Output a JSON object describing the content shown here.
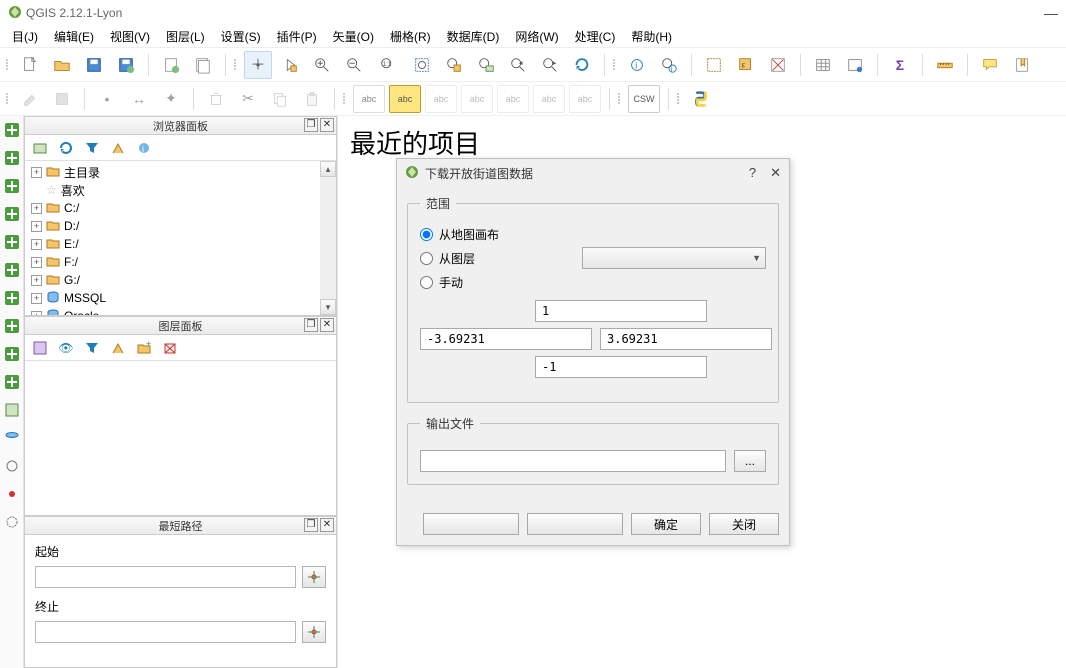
{
  "window": {
    "title": "QGIS 2.12.1-Lyon"
  },
  "menu": {
    "items": [
      "目(J)",
      "编辑(E)",
      "视图(V)",
      "图层(L)",
      "设置(S)",
      "插件(P)",
      "矢量(O)",
      "栅格(R)",
      "数据库(D)",
      "网络(W)",
      "处理(C)",
      "帮助(H)"
    ]
  },
  "recent": {
    "heading": "最近的项目"
  },
  "browser_panel": {
    "title": "浏览器面板",
    "tree": [
      {
        "label": "主目录",
        "icon": "folder",
        "expandable": true
      },
      {
        "label": "喜欢",
        "icon": "star",
        "expandable": false
      },
      {
        "label": "C:/",
        "icon": "folder",
        "expandable": true
      },
      {
        "label": "D:/",
        "icon": "folder",
        "expandable": true
      },
      {
        "label": "E:/",
        "icon": "folder",
        "expandable": true
      },
      {
        "label": "F:/",
        "icon": "folder",
        "expandable": true
      },
      {
        "label": "G:/",
        "icon": "folder",
        "expandable": true
      },
      {
        "label": "MSSQL",
        "icon": "db",
        "expandable": true
      },
      {
        "label": "Oracle",
        "icon": "db",
        "expandable": true
      }
    ]
  },
  "layers_panel": {
    "title": "图层面板"
  },
  "route_panel": {
    "title": "最短路径",
    "start_label": "起始",
    "end_label": "终止",
    "start_value": "",
    "end_value": ""
  },
  "dialog": {
    "title": "下载开放街道图数据",
    "group_extent": "范围",
    "radio_canvas": "从地图画布",
    "radio_layer": "从图层",
    "radio_manual": "手动",
    "top": "1",
    "left": "-3.69231",
    "right": "3.69231",
    "bottom": "-1",
    "group_output": "输出文件",
    "output_path": "",
    "browse": "...",
    "ok": "确定",
    "close": "关闭"
  }
}
